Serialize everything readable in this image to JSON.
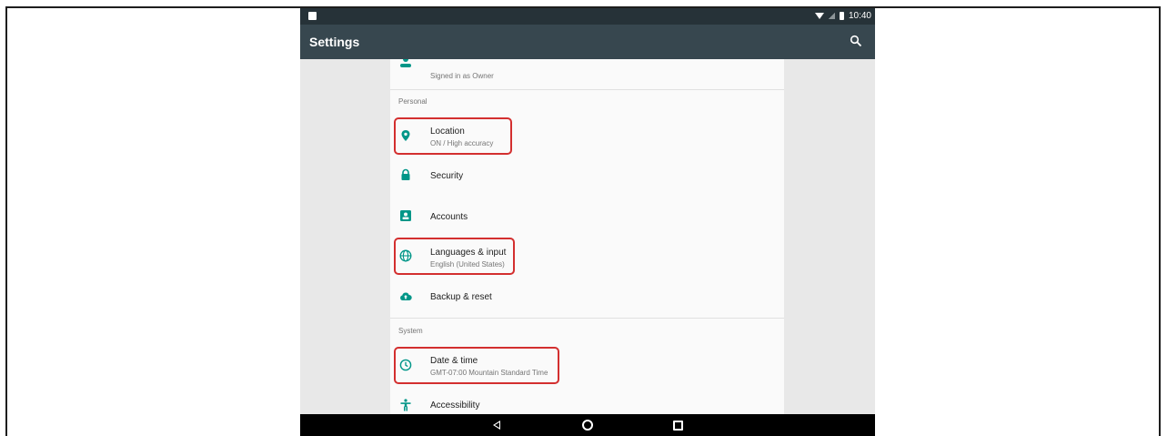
{
  "statusbar": {
    "time": "10:40"
  },
  "appbar": {
    "title": "Settings"
  },
  "users": {
    "subtitle": "Signed in as Owner"
  },
  "sections": {
    "personal": "Personal",
    "system": "System"
  },
  "items": {
    "location": {
      "title": "Location",
      "subtitle": "ON / High accuracy",
      "icon": "location-pin-icon"
    },
    "security": {
      "title": "Security",
      "icon": "lock-icon"
    },
    "accounts": {
      "title": "Accounts",
      "icon": "account-box-icon"
    },
    "languages": {
      "title": "Languages & input",
      "subtitle": "English (United States)",
      "icon": "globe-icon"
    },
    "backup": {
      "title": "Backup & reset",
      "icon": "cloud-upload-icon"
    },
    "datetime": {
      "title": "Date & time",
      "subtitle": "GMT-07:00 Mountain Standard Time",
      "icon": "clock-icon"
    },
    "accessibility": {
      "title": "Accessibility",
      "icon": "accessibility-icon"
    }
  },
  "colors": {
    "accent": "#009688",
    "appbar": "#37474f",
    "statusbar": "#263238",
    "highlight": "#d32f2f"
  }
}
